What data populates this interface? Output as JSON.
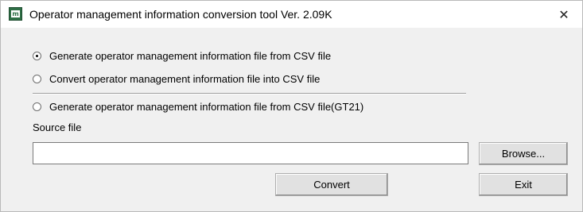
{
  "window": {
    "title": "Operator management information conversion tool Ver. 2.09K",
    "close_glyph": "✕",
    "app_icon_glyph": "m"
  },
  "options": [
    {
      "label": "Generate operator management information file from CSV file",
      "checked": true
    },
    {
      "label": "Convert operator management information file into CSV file",
      "checked": false
    },
    {
      "label": "Generate operator management information file from CSV file(GT21)",
      "checked": false
    }
  ],
  "source": {
    "label": "Source file",
    "value": ""
  },
  "buttons": {
    "browse": "Browse...",
    "convert": "Convert",
    "exit": "Exit"
  }
}
